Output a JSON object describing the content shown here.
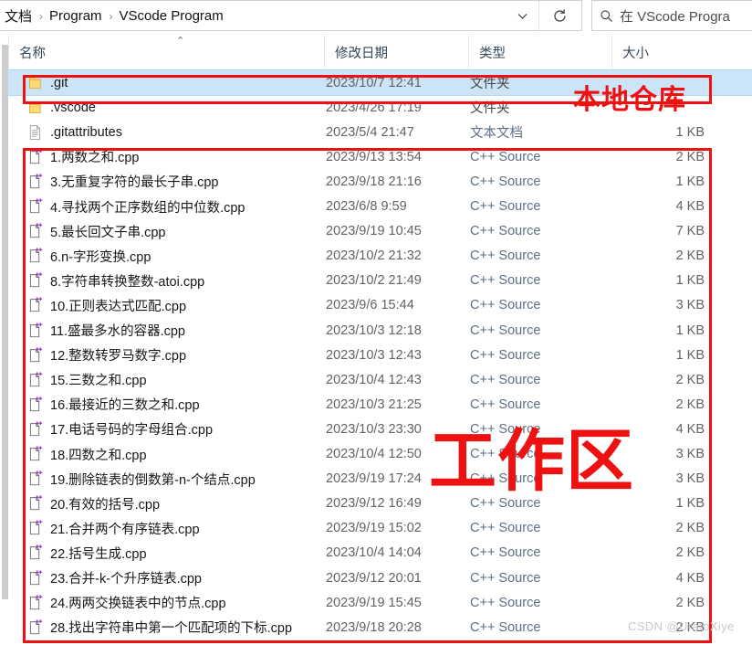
{
  "window": {
    "breadcrumb": [
      "文档",
      "Program",
      "VScode Program"
    ],
    "breadcrumb_separator": "›",
    "address_caret_icon": "chevron-down-icon",
    "refresh_icon": "refresh-icon",
    "search_icon": "search-icon",
    "search_placeholder": "在 VScode Progra"
  },
  "columns": {
    "name": "名称",
    "date": "修改日期",
    "type": "类型",
    "size": "大小",
    "sort_caret": "⌃"
  },
  "annotations": {
    "local_repo": "本地仓库",
    "workspace": "工作区",
    "box_color": "#ee1111"
  },
  "watermark": "CSDN @UratoXiye",
  "files": [
    {
      "name": ".git",
      "date": "2023/10/7 12:41",
      "type": "文件夹",
      "size": "",
      "icon": "folder-icon",
      "selected": true
    },
    {
      "name": ".vscode",
      "date": "2023/4/26 17:19",
      "type": "文件夹",
      "size": "",
      "icon": "folder-icon",
      "selected": false
    },
    {
      "name": ".gitattributes",
      "date": "2023/5/4 21:47",
      "type": "文本文档",
      "size": "1 KB",
      "icon": "text-file-icon",
      "selected": false
    },
    {
      "name": "1.两数之和.cpp",
      "date": "2023/9/13 13:54",
      "type": "C++ Source",
      "size": "2 KB",
      "icon": "cpp-file-icon",
      "selected": false
    },
    {
      "name": "3.无重复字符的最长子串.cpp",
      "date": "2023/9/18 21:16",
      "type": "C++ Source",
      "size": "1 KB",
      "icon": "cpp-file-icon",
      "selected": false
    },
    {
      "name": "4.寻找两个正序数组的中位数.cpp",
      "date": "2023/6/8 9:59",
      "type": "C++ Source",
      "size": "4 KB",
      "icon": "cpp-file-icon",
      "selected": false
    },
    {
      "name": "5.最长回文子串.cpp",
      "date": "2023/9/19 10:45",
      "type": "C++ Source",
      "size": "7 KB",
      "icon": "cpp-file-icon",
      "selected": false
    },
    {
      "name": "6.n-字形变换.cpp",
      "date": "2023/10/2 21:32",
      "type": "C++ Source",
      "size": "2 KB",
      "icon": "cpp-file-icon",
      "selected": false
    },
    {
      "name": "8.字符串转换整数-atoi.cpp",
      "date": "2023/10/2 21:49",
      "type": "C++ Source",
      "size": "1 KB",
      "icon": "cpp-file-icon",
      "selected": false
    },
    {
      "name": "10.正则表达式匹配.cpp",
      "date": "2023/9/6 15:44",
      "type": "C++ Source",
      "size": "3 KB",
      "icon": "cpp-file-icon",
      "selected": false
    },
    {
      "name": "11.盛最多水的容器.cpp",
      "date": "2023/10/3 12:18",
      "type": "C++ Source",
      "size": "1 KB",
      "icon": "cpp-file-icon",
      "selected": false
    },
    {
      "name": "12.整数转罗马数字.cpp",
      "date": "2023/10/3 12:43",
      "type": "C++ Source",
      "size": "1 KB",
      "icon": "cpp-file-icon",
      "selected": false
    },
    {
      "name": "15.三数之和.cpp",
      "date": "2023/10/4 12:43",
      "type": "C++ Source",
      "size": "2 KB",
      "icon": "cpp-file-icon",
      "selected": false
    },
    {
      "name": "16.最接近的三数之和.cpp",
      "date": "2023/10/3 21:25",
      "type": "C++ Source",
      "size": "2 KB",
      "icon": "cpp-file-icon",
      "selected": false
    },
    {
      "name": "17.电话号码的字母组合.cpp",
      "date": "2023/10/3 23:30",
      "type": "C++ Source",
      "size": "4 KB",
      "icon": "cpp-file-icon",
      "selected": false
    },
    {
      "name": "18.四数之和.cpp",
      "date": "2023/10/4 12:50",
      "type": "C++ Source",
      "size": "3 KB",
      "icon": "cpp-file-icon",
      "selected": false
    },
    {
      "name": "19.删除链表的倒数第-n-个结点.cpp",
      "date": "2023/9/19 17:24",
      "type": "C++ Source",
      "size": "3 KB",
      "icon": "cpp-file-icon",
      "selected": false
    },
    {
      "name": "20.有效的括号.cpp",
      "date": "2023/9/12 16:49",
      "type": "C++ Source",
      "size": "1 KB",
      "icon": "cpp-file-icon",
      "selected": false
    },
    {
      "name": "21.合并两个有序链表.cpp",
      "date": "2023/9/19 15:02",
      "type": "C++ Source",
      "size": "2 KB",
      "icon": "cpp-file-icon",
      "selected": false
    },
    {
      "name": "22.括号生成.cpp",
      "date": "2023/10/4 14:04",
      "type": "C++ Source",
      "size": "2 KB",
      "icon": "cpp-file-icon",
      "selected": false
    },
    {
      "name": "23.合并-k-个升序链表.cpp",
      "date": "2023/9/12 20:01",
      "type": "C++ Source",
      "size": "4 KB",
      "icon": "cpp-file-icon",
      "selected": false
    },
    {
      "name": "24.两两交换链表中的节点.cpp",
      "date": "2023/9/19 15:45",
      "type": "C++ Source",
      "size": "2 KB",
      "icon": "cpp-file-icon",
      "selected": false
    },
    {
      "name": "28.找出字符串中第一个匹配项的下标.cpp",
      "date": "2023/9/18 20:28",
      "type": "C++ Source",
      "size": "2 KB",
      "icon": "cpp-file-icon",
      "selected": false
    }
  ]
}
